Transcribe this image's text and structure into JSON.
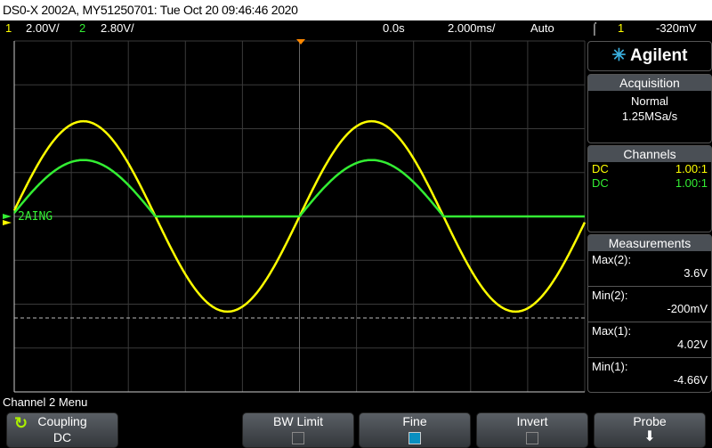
{
  "title": "DS0-X 2002A, MY51250701: Tue Oct 20 09:46:46 2020",
  "status": {
    "ch1_num": "1",
    "ch1_scale": "2.00V/",
    "ch2_num": "2",
    "ch2_scale": "2.80V/",
    "delay": "0.0s",
    "timebase": "2.000ms/",
    "trigger_mode": "Auto",
    "trigger_source": "1",
    "trigger_level": "-320mV",
    "trigger_edge_icon": "rising-edge-icon"
  },
  "plot": {
    "ch2_label": "2AING",
    "colors": {
      "ch1": "#ffff00",
      "ch2": "#33ee33",
      "grid": "#444444"
    }
  },
  "waveforms": {
    "time_per_div_ms": 2,
    "ch1": {
      "volts_per_div": 2.0,
      "max_v": 4.02,
      "min_v": -4.66,
      "period_ms": 10.1
    },
    "ch2": {
      "volts_per_div": 2.8,
      "max_v": 3.6,
      "min_v": -0.2
    }
  },
  "brand": "Agilent",
  "acquisition": {
    "header": "Acquisition",
    "mode": "Normal",
    "rate": "1.25MSa/s"
  },
  "channels": {
    "header": "Channels",
    "rows": [
      {
        "coupling": "DC",
        "probe": "1.00:1"
      },
      {
        "coupling": "DC",
        "probe": "1.00:1"
      }
    ]
  },
  "measurements": {
    "header": "Measurements",
    "items": [
      {
        "label": "Max(2):",
        "value": "3.6V"
      },
      {
        "label": "Min(2):",
        "value": "-200mV"
      },
      {
        "label": "Max(1):",
        "value": "4.02V"
      },
      {
        "label": "Min(1):",
        "value": "-4.66V"
      }
    ]
  },
  "menu": {
    "title": "Channel 2 Menu",
    "softkeys": [
      {
        "label": "Coupling",
        "value": "DC"
      },
      {
        "label": "BW Limit",
        "checked": false
      },
      {
        "label": "Fine",
        "checked": true
      },
      {
        "label": "Invert",
        "checked": false
      },
      {
        "label": "Probe"
      }
    ]
  }
}
